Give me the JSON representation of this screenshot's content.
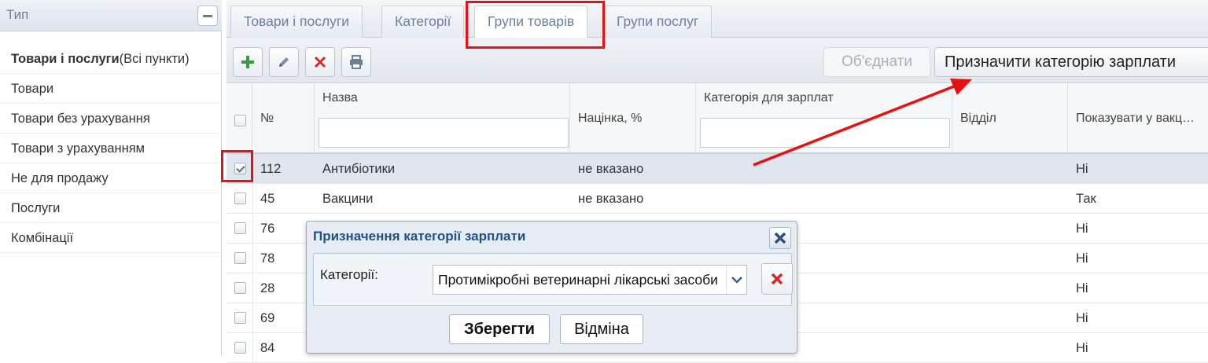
{
  "sidebar": {
    "title": "Тип",
    "items": [
      {
        "label_bold": "Товари і послуги",
        "label_rest": "(Всі пункти)"
      },
      {
        "label_bold": "",
        "label_rest": "Товари"
      },
      {
        "label_bold": "",
        "label_rest": "Товари без урахування"
      },
      {
        "label_bold": "",
        "label_rest": "Товари з урахуванням"
      },
      {
        "label_bold": "",
        "label_rest": "Не для продажу"
      },
      {
        "label_bold": "",
        "label_rest": "Послуги"
      },
      {
        "label_bold": "",
        "label_rest": "Комбінації"
      }
    ]
  },
  "tabs": [
    {
      "label": "Товари і послуги",
      "active": false
    },
    {
      "label": "Категорії",
      "active": false
    },
    {
      "label": "Групи товарів",
      "active": true
    },
    {
      "label": "Групи послуг",
      "active": false
    }
  ],
  "toolbar": {
    "add_icon": "plus-icon",
    "edit_icon": "pencil-icon",
    "delete_icon": "x-icon",
    "print_icon": "printer-icon",
    "merge_label": "Об'єднати",
    "assign_label": "Призначити категорію зарплати"
  },
  "grid": {
    "columns": {
      "num": "№",
      "name": "Назва",
      "markup": "Націнка, %",
      "salary_cat": "Категорія для зарплат",
      "dept": "Відділ",
      "show": "Показувати у вакц…"
    },
    "rows": [
      {
        "num": "112",
        "name": "Антибіотики",
        "markup": "не вказано",
        "show": "Ні",
        "checked": true
      },
      {
        "num": "45",
        "name": "Вакцини",
        "markup": "не вказано",
        "show": "Так",
        "checked": false
      },
      {
        "num": "76",
        "name": "",
        "markup": "",
        "show": "Ні",
        "checked": false
      },
      {
        "num": "78",
        "name": "",
        "markup": "",
        "show": "Ні",
        "checked": false
      },
      {
        "num": "28",
        "name": "",
        "markup": "",
        "show": "Ні",
        "checked": false
      },
      {
        "num": "69",
        "name": "",
        "markup": "",
        "show": "Ні",
        "checked": false
      },
      {
        "num": "84",
        "name": "",
        "markup": "",
        "show": "Ні",
        "checked": false
      }
    ]
  },
  "dialog": {
    "title": "Призначення категорії зарплати",
    "field_label": "Категорії:",
    "select_value": "Протимікробні ветеринарні лікарські засоби",
    "save_label": "Зберегти",
    "cancel_label": "Відміна"
  },
  "colors": {
    "accent": "#1f4f8f",
    "highlight": "#e81010",
    "add_green": "#3a9a3a",
    "delete_red": "#d22a2a"
  }
}
